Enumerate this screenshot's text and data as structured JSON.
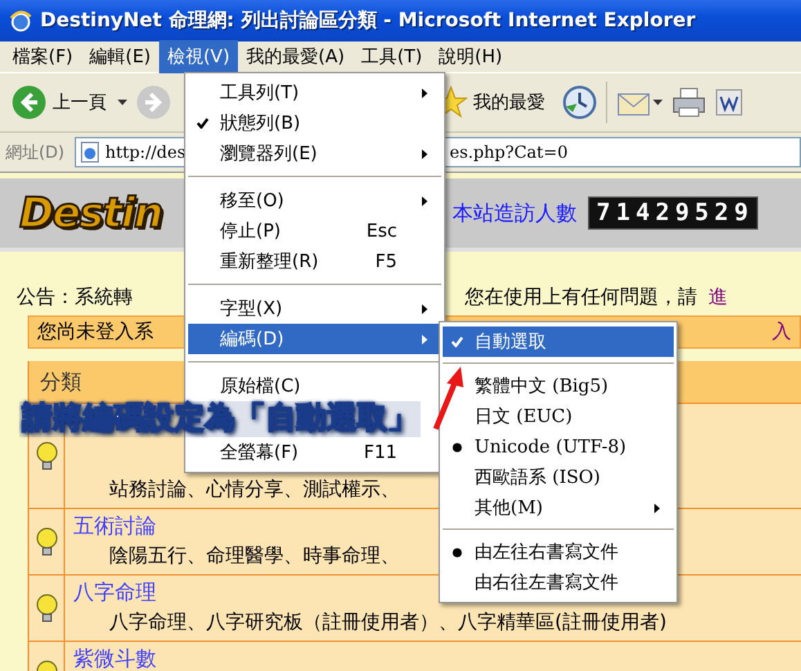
{
  "window": {
    "title": "DestinyNet 命理網: 列出討論區分類 - Microsoft Internet Explorer"
  },
  "menu_bar": [
    {
      "label": "檔案(F)",
      "selected": false
    },
    {
      "label": "編輯(E)",
      "selected": false
    },
    {
      "label": "檢視(V)",
      "selected": true
    },
    {
      "label": "我的最愛(A)",
      "selected": false
    },
    {
      "label": "工具(T)",
      "selected": false
    },
    {
      "label": "說明(H)",
      "selected": false
    }
  ],
  "toolbar": {
    "back": "上一頁",
    "favorites": "我的最愛"
  },
  "address_bar": {
    "label": "網址(D)",
    "value_start": "http://des",
    "value_end": "es.php?Cat=0"
  },
  "view_menu": [
    {
      "kind": "check",
      "label": "工具列(T)",
      "submenu": true,
      "checked": false,
      "selected": false
    },
    {
      "kind": "check",
      "label": "狀態列(B)",
      "submenu": false,
      "checked": true,
      "selected": false
    },
    {
      "kind": "check",
      "label": "瀏覽器列(E)",
      "submenu": true,
      "checked": false,
      "selected": false
    },
    {
      "kind": "separator"
    },
    {
      "kind": "check",
      "label": "移至(O)",
      "submenu": true,
      "checked": false,
      "selected": false
    },
    {
      "kind": "check",
      "label": "停止(P)",
      "shortcut": "Esc",
      "submenu": false,
      "checked": false,
      "selected": false
    },
    {
      "kind": "check",
      "label": "重新整理(R)",
      "shortcut": "F5",
      "submenu": false,
      "checked": false,
      "selected": false
    },
    {
      "kind": "separator"
    },
    {
      "kind": "check",
      "label": "字型(X)",
      "submenu": true,
      "checked": false,
      "selected": false
    },
    {
      "kind": "check",
      "label": "編碼(D)",
      "submenu": true,
      "checked": false,
      "selected": true
    },
    {
      "kind": "separator"
    },
    {
      "kind": "check",
      "label": "原始檔(C)",
      "submenu": false,
      "checked": false,
      "selected": false
    },
    {
      "kind": "hidden"
    },
    {
      "kind": "check",
      "label": "全螢幕(F)",
      "shortcut": "F11",
      "submenu": false,
      "checked": false,
      "selected": false
    }
  ],
  "encoding_menu": [
    {
      "kind": "check",
      "label": "自動選取",
      "submenu": false,
      "checked": true,
      "selected": true
    },
    {
      "kind": "separator"
    },
    {
      "kind": "radio",
      "label": "繁體中文 (Big5)",
      "submenu": false,
      "checked": false,
      "selected": false
    },
    {
      "kind": "radio",
      "label": "日文 (EUC)",
      "submenu": false,
      "checked": false,
      "selected": false
    },
    {
      "kind": "radio",
      "label": "Unicode (UTF-8)",
      "submenu": false,
      "checked": true,
      "selected": false
    },
    {
      "kind": "radio",
      "label": "西歐語系 (ISO)",
      "submenu": false,
      "checked": false,
      "selected": false
    },
    {
      "kind": "check",
      "label": "其他(M)",
      "submenu": true,
      "checked": false,
      "selected": false
    },
    {
      "kind": "separator"
    },
    {
      "kind": "radio",
      "label": "由左往右書寫文件",
      "submenu": false,
      "checked": true,
      "selected": false
    },
    {
      "kind": "radio",
      "label": "由右往左書寫文件",
      "submenu": false,
      "checked": false,
      "selected": false
    }
  ],
  "banner": {
    "logo": "Destin",
    "counter_label": "本站造訪人數",
    "counter": "71429529"
  },
  "notice": {
    "text_start": "公告：系統轉",
    "text_end": "您在使用上有任何問題，請",
    "link": "進"
  },
  "login_bar": {
    "text": "您尚未登入系",
    "link": "入"
  },
  "forum_table": {
    "header": "分類",
    "rows": [
      {
        "description": "站務討論、心情分享、測試權示、"
      },
      {
        "title": "五術討論",
        "description": "陰陽五行、命理醫學、時事命理、"
      },
      {
        "title": "八字命理",
        "description": "八字命理、八字研究板（註冊使用者）、八字精華區(註冊使用者)"
      },
      {
        "title": "紫微斗數"
      }
    ]
  },
  "callout": {
    "text": "請將編碼設定為「自動選取」"
  }
}
